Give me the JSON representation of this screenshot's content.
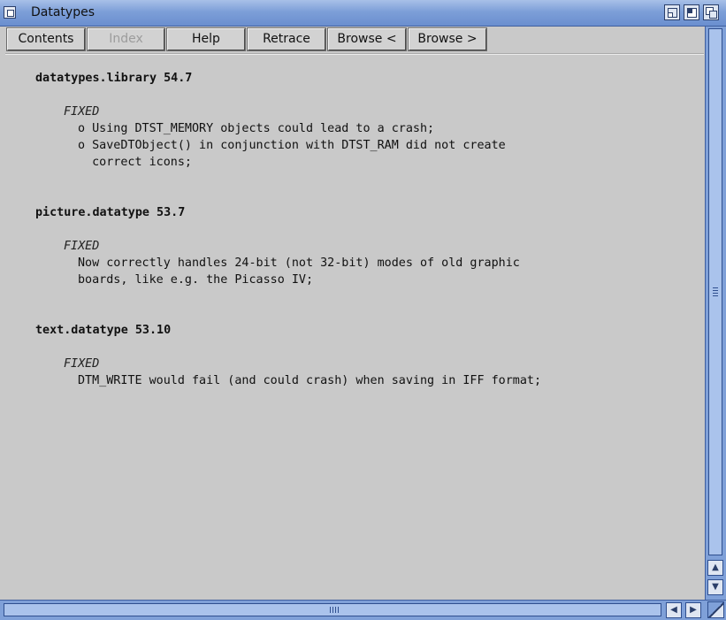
{
  "window": {
    "title": "Datatypes",
    "gadgets": [
      "close-icon",
      "iconify-icon",
      "zoom-icon",
      "depth-icon"
    ]
  },
  "toolbar": {
    "buttons": [
      {
        "label": "Contents",
        "enabled": true
      },
      {
        "label": "Index",
        "enabled": false
      },
      {
        "label": "Help",
        "enabled": true
      },
      {
        "label": "Retrace",
        "enabled": true
      },
      {
        "label": "Browse <",
        "enabled": true
      },
      {
        "label": "Browse >",
        "enabled": true
      }
    ]
  },
  "document": {
    "sections": [
      {
        "heading": "datatypes.library 54.7",
        "tag": "FIXED",
        "lines": [
          "o Using DTST_MEMORY objects could lead to a crash;",
          "o SaveDTObject() in conjunction with DTST_RAM did not create",
          "  correct icons;"
        ]
      },
      {
        "heading": "picture.datatype 53.7",
        "tag": "FIXED",
        "lines": [
          "Now correctly handles 24-bit (not 32-bit) modes of old graphic",
          "boards, like e.g. the Picasso IV;"
        ]
      },
      {
        "heading": "text.datatype 53.10",
        "tag": "FIXED",
        "lines": [
          "DTM_WRITE would fail (and could crash) when saving in IFF format;"
        ]
      }
    ]
  },
  "scrollbars": {
    "vertical": {
      "up_icon": "arrow-up-icon",
      "down_icon": "arrow-down-icon"
    },
    "horizontal": {
      "left_icon": "arrow-left-icon",
      "right_icon": "arrow-right-icon"
    }
  },
  "colors": {
    "window_background": "#c9c9c9",
    "titlebar": "#7d9fd8",
    "scrollbar": "#7fa0d8"
  }
}
